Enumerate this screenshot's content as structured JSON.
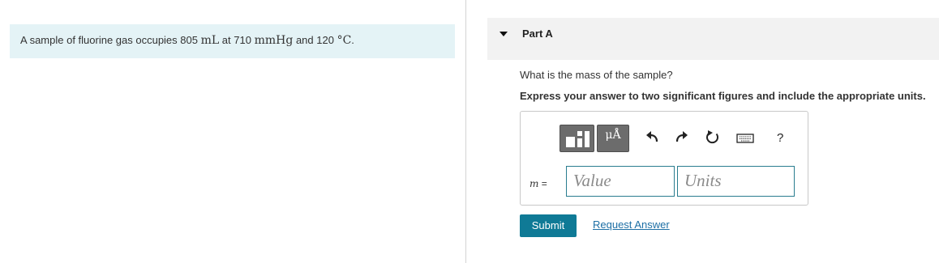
{
  "problem": {
    "text_before": "A sample of fluorine gas occupies 805",
    "volume_unit": "mL",
    "text_at1": "at 710",
    "pressure_unit": "mmHg",
    "text_and": "and 120",
    "temp_unit": "°C",
    "text_end": "."
  },
  "part": {
    "title": "Part A",
    "question": "What is the mass of the sample?",
    "instruction": "Express your answer to two significant figures and include the appropriate units."
  },
  "answer": {
    "variable": "m",
    "equals": "=",
    "value_placeholder": "Value",
    "units_placeholder": "Units",
    "units_button_glyph": "μÅ",
    "help_label": "?"
  },
  "toolbar": {
    "icons": [
      "templates-icon",
      "units-icon",
      "undo-icon",
      "redo-icon",
      "reset-icon",
      "keyboard-icon",
      "help-icon"
    ]
  },
  "actions": {
    "submit_label": "Submit",
    "request_label": "Request Answer"
  },
  "colors": {
    "problem_bg": "#e4f3f6",
    "header_bg": "#f2f2f2",
    "submit_bg": "#0f7a96",
    "link": "#1d6fa5",
    "input_border": "#2a7d8f"
  }
}
